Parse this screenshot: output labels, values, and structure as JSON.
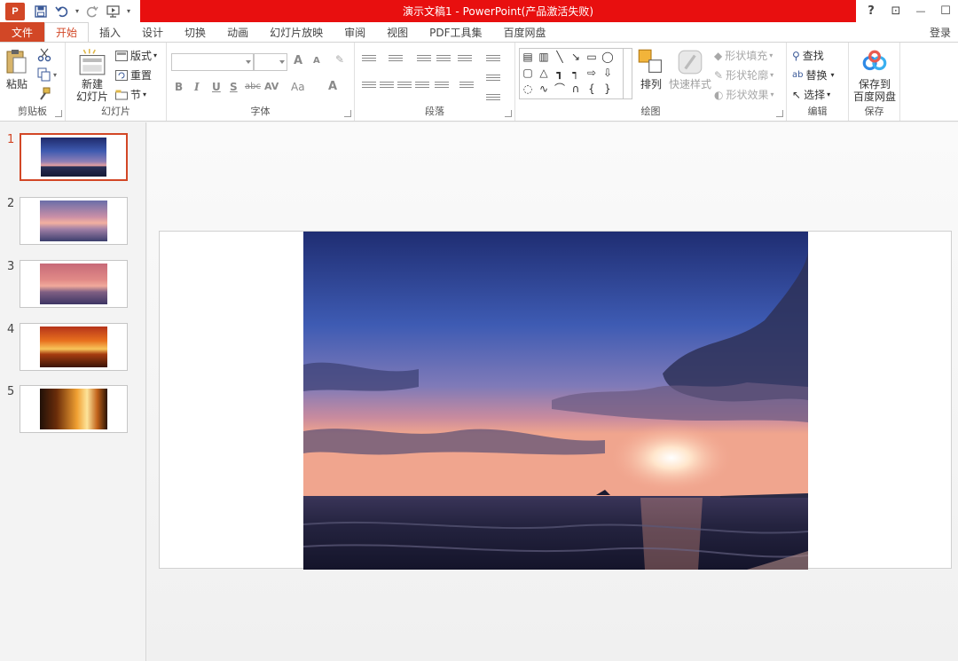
{
  "app": {
    "title": "演示文稿1 - PowerPoint(产品激活失败)",
    "logo_letter": "P",
    "colors": {
      "accent": "#d24726",
      "title_bar": "#e80f0f"
    }
  },
  "window": {
    "help": "?",
    "restore_ribbon": "⊡",
    "minimize": "—",
    "maximize": "☐"
  },
  "tabs": {
    "file": "文件",
    "items": [
      "开始",
      "插入",
      "设计",
      "切换",
      "动画",
      "幻灯片放映",
      "审阅",
      "视图",
      "PDF工具集",
      "百度网盘"
    ],
    "login": "登录"
  },
  "ribbon": {
    "clipboard": {
      "label": "剪贴板",
      "paste": "粘贴"
    },
    "slides": {
      "label": "幻灯片",
      "new_slide_line1": "新建",
      "new_slide_line2": "幻灯片",
      "layout": "版式",
      "reset": "重置",
      "section": "节"
    },
    "font": {
      "label": "字体",
      "bold": "B",
      "italic": "I",
      "underline": "U",
      "shadow": "S",
      "strike": "abc",
      "spacing": "AV",
      "case": "Aa",
      "color": "A",
      "grow": "A",
      "shrink": "A"
    },
    "paragraph": {
      "label": "段落"
    },
    "drawing": {
      "label": "绘图",
      "arrange": "排列",
      "quick_styles": "快速样式",
      "fill": "形状填充",
      "outline": "形状轮廓",
      "effects": "形状效果"
    },
    "editing": {
      "label": "编辑",
      "find": "查找",
      "replace": "替换",
      "select": "选择"
    },
    "save": {
      "label": "保存",
      "line1": "保存到",
      "line2": "百度网盘"
    }
  },
  "slides": [
    {
      "number": "1",
      "active": true
    },
    {
      "number": "2",
      "active": false
    },
    {
      "number": "3",
      "active": false
    },
    {
      "number": "4",
      "active": false
    },
    {
      "number": "5",
      "active": false
    }
  ]
}
